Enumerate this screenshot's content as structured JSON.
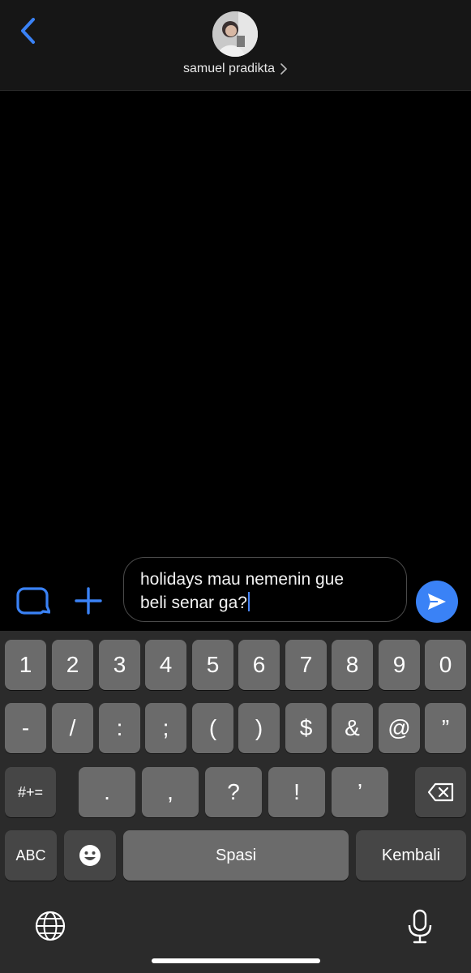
{
  "header": {
    "contact_name": "samuel pradikta"
  },
  "composer": {
    "text_line1": "holidays mau nemenin gue",
    "text_line2": "beli senar ga?"
  },
  "keyboard": {
    "row1": [
      "1",
      "2",
      "3",
      "4",
      "5",
      "6",
      "7",
      "8",
      "9",
      "0"
    ],
    "row2": [
      "-",
      "/",
      ":",
      ";",
      "(",
      ")",
      "$",
      "&",
      "@",
      "”"
    ],
    "row3": [
      ".",
      ",",
      "?",
      "!",
      "’"
    ],
    "symbols_key": "#+=",
    "abc_key": "ABC",
    "space_key": "Spasi",
    "return_key": "Kembali"
  },
  "icons": {
    "back": "chevron-left-icon",
    "chevron": "chevron-right-icon",
    "bubble": "chat-bubble-icon",
    "plus": "plus-icon",
    "send": "send-icon",
    "delete": "backspace-icon",
    "emoji": "emoji-icon",
    "globe": "globe-icon",
    "mic": "microphone-icon"
  },
  "colors": {
    "accent": "#3a82f6",
    "key": "#6b6b6b",
    "key_dark": "#464646",
    "keyboard_bg": "#2b2b2b"
  }
}
